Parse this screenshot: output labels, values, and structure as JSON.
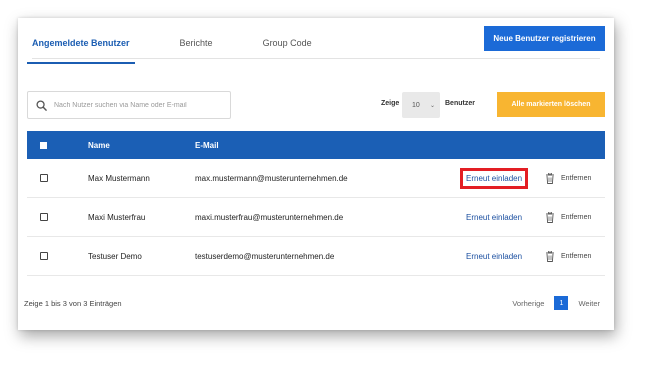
{
  "tabs": [
    {
      "label": "Angemeldete Benutzer",
      "active": true
    },
    {
      "label": "Berichte",
      "active": false
    },
    {
      "label": "Group Code",
      "active": false
    }
  ],
  "register_button": "Neue Benutzer registrieren",
  "search": {
    "placeholder": "Nach Nutzer suchen via Name oder E-mail",
    "icon": "search-icon"
  },
  "page_size": {
    "prefix": "Zeige",
    "value": "10",
    "suffix": "Benutzer"
  },
  "delete_marked_button": "Alle markierten löschen",
  "table": {
    "columns": [
      "Name",
      "E-Mail"
    ],
    "rows": [
      {
        "name": "Max Mustermann",
        "email": "max.mustermann@musterunternehmen.de",
        "invite": "Erneut einladen",
        "remove": "Entfernen",
        "highlighted": true
      },
      {
        "name": "Maxi Musterfrau",
        "email": "maxi.musterfrau@musterunternehmen.de",
        "invite": "Erneut einladen",
        "remove": "Entfernen",
        "highlighted": false
      },
      {
        "name": "Testuser Demo",
        "email": "testuserdemo@musterunternehmen.de",
        "invite": "Erneut einladen",
        "remove": "Entfernen",
        "highlighted": false
      }
    ]
  },
  "footer": {
    "entries_info": "Zeige 1 bis 3 von 3 Einträgen",
    "prev": "Vorherige",
    "current_page": "1",
    "next": "Weiter"
  },
  "colors": {
    "primary": "#1b6ad7",
    "header": "#1b5fb5",
    "warning": "#f8b531",
    "highlight": "#e31e24"
  }
}
